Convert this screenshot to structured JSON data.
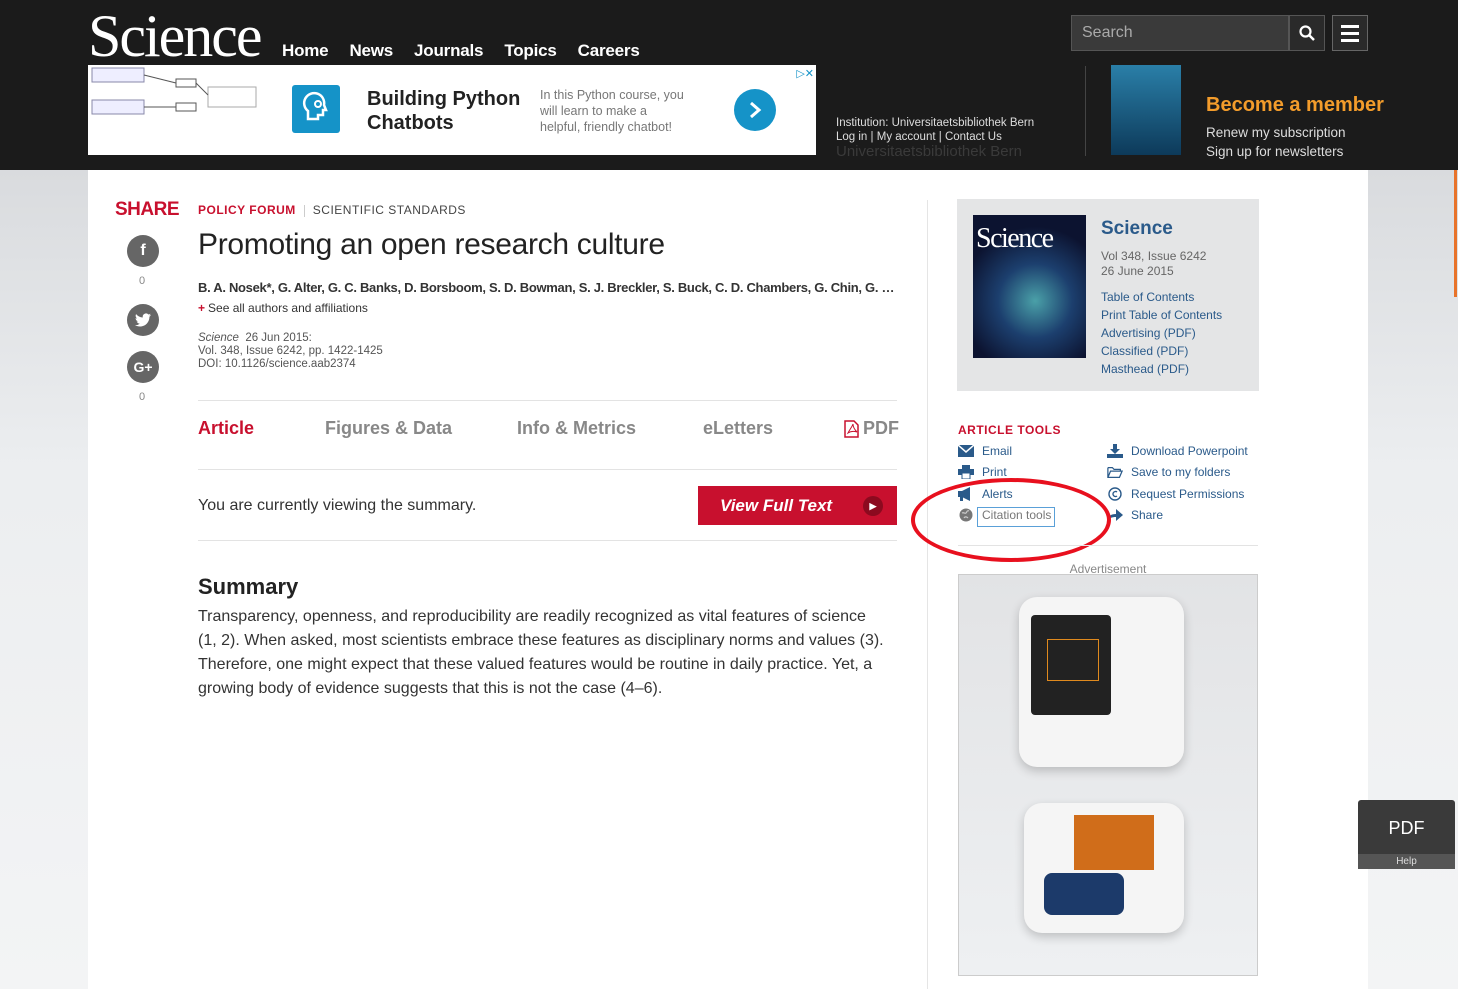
{
  "header": {
    "logo": "Science",
    "nav": [
      "Home",
      "News",
      "Journals",
      "Topics",
      "Careers"
    ],
    "search_placeholder": "Search"
  },
  "ad_banner": {
    "title": "Building Python Chatbots",
    "text": "In this Python course, you will learn to make a helpful, friendly chatbot!"
  },
  "institution": {
    "line": "Institution: Universitaetsbibliothek Bern",
    "links": [
      "Log in",
      "My account",
      "Contact Us"
    ],
    "name": "Universitaetsbibliothek Bern"
  },
  "membership": {
    "title": "Become a member",
    "renew": "Renew my subscription",
    "signup": "Sign up for newsletters"
  },
  "share": {
    "title": "SHARE",
    "facebook_count": "0",
    "gplus_count": "0"
  },
  "article": {
    "section": "POLICY FORUM",
    "subsection": "SCIENTIFIC STANDARDS",
    "title": "Promoting an open research culture",
    "authors": "B. A. Nosek*, G. Alter, G. C. Banks, D. Borsboom, S. D. Bowman, S. J. Breckler, S. Buck, C. D. Chambers, G. Chin, G. Christe…",
    "see_all": "See all authors and affiliations",
    "journal": "Science",
    "date": "26 Jun 2015:",
    "volume": "Vol. 348, Issue 6242, pp. 1422-1425",
    "doi": "DOI: 10.1126/science.aab2374"
  },
  "tabs": [
    "Article",
    "Figures & Data",
    "Info & Metrics",
    "eLetters",
    "PDF"
  ],
  "viewing": {
    "text": "You are currently viewing the summary.",
    "button": "View Full Text"
  },
  "summary": {
    "heading": "Summary",
    "body": "Transparency, openness, and reproducibility are readily recognized as vital features of science (1, 2). When asked, most scientists embrace these features as disciplinary norms and values (3). Therefore, one might expect that these valued features would be routine in daily practice. Yet, a growing body of evidence suggests that this is not the case (4–6)."
  },
  "issue": {
    "name": "Science",
    "volume": "Vol 348, Issue 6242",
    "date": "26 June 2015",
    "links": [
      "Table of Contents",
      "Print Table of Contents",
      "Advertising (PDF)",
      "Classified (PDF)",
      "Masthead (PDF)"
    ]
  },
  "article_tools": {
    "heading": "ARTICLE TOOLS",
    "left": [
      "Email",
      "Print",
      "Alerts",
      "Citation tools"
    ],
    "right": [
      "Download Powerpoint",
      "Save to my folders",
      "Request Permissions",
      "Share"
    ]
  },
  "advertisement_label": "Advertisement",
  "pdf_widget": {
    "label": "PDF",
    "help": "Help"
  },
  "colors": {
    "brand_red": "#c8102e",
    "link_blue": "#2a5a8a",
    "member_orange": "#f39c2b",
    "annotation_red": "#e8101e"
  }
}
